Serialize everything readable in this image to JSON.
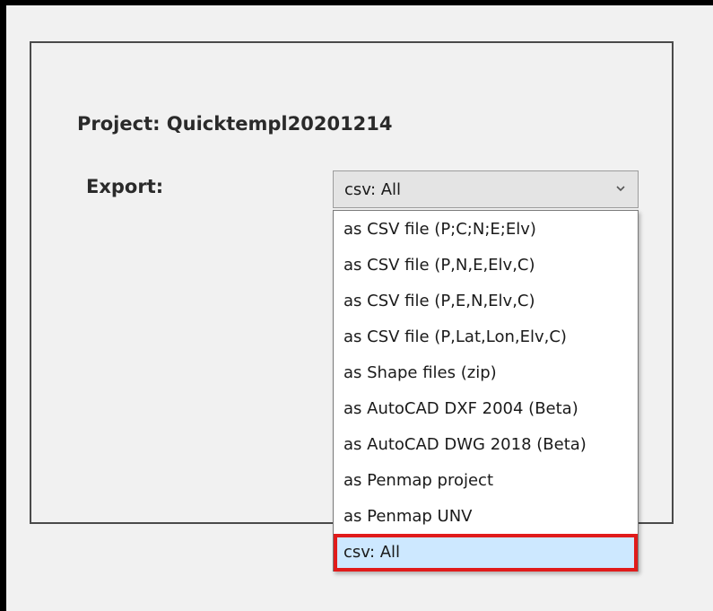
{
  "project": {
    "title": "Project: Quicktempl20201214"
  },
  "export": {
    "label": "Export:",
    "selected_value": "csv: All",
    "options": [
      {
        "label": "as CSV file (P;C;N;E;Elv)"
      },
      {
        "label": "as CSV file (P,N,E,Elv,C)"
      },
      {
        "label": "as CSV file (P,E,N,Elv,C)"
      },
      {
        "label": "as CSV file (P,Lat,Lon,Elv,C)"
      },
      {
        "label": "as Shape files (zip)"
      },
      {
        "label": "as AutoCAD DXF 2004 (Beta)"
      },
      {
        "label": "as AutoCAD DWG 2018 (Beta)"
      },
      {
        "label": "as Penmap project"
      },
      {
        "label": "as Penmap UNV"
      },
      {
        "label": "csv: All"
      }
    ],
    "selected_index": 9
  },
  "colors": {
    "highlight_border": "#e01b1b",
    "selected_background": "#cde8ff"
  },
  "icons": {
    "dropdown_arrow": "chevron-down-icon"
  }
}
